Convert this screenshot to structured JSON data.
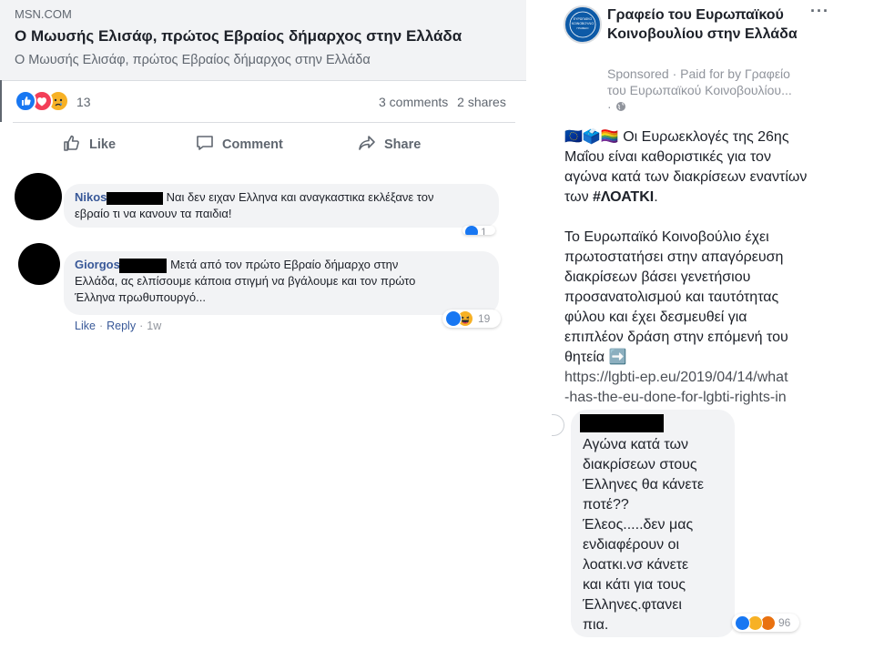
{
  "link_preview": {
    "domain": "MSN.COM",
    "title": "Ο Μωυσής Ελισάφ, πρώτος Εβραίος δήμαρχος στην Ελλάδα",
    "description": "Ο Μωυσής Ελισάφ, πρώτος Εβραίος δήμαρχος στην Ελλάδα"
  },
  "post_stats": {
    "reaction_count": "13",
    "comments": "3 comments",
    "shares": "2 shares",
    "reaction_icons": [
      "like-icon",
      "love-icon",
      "sad-icon"
    ]
  },
  "actions": {
    "like": "Like",
    "comment": "Comment",
    "share": "Share"
  },
  "comments": [
    {
      "author": "Nikos",
      "text_line1": "Ναι δεν ειχαν Ελληνα και αναγκαστικα εκλέξανε τον",
      "text_line2": "εβραίο τι να κανουν τα παιδια!",
      "reaction_count": "1"
    },
    {
      "author": "Giorgos",
      "text_line1": "Μετά από τον πρώτο Εβραίο δήμαρχο στην",
      "text_line2": "Ελλάδα, ας ελπίσουμε κάποια στιγμή να βγάλουμε και τον πρώτο",
      "text_line3": "Έλληνα πρωθυπουργό...",
      "like_label": "Like",
      "reply_label": "Reply",
      "time": "1w",
      "reaction_count": "19",
      "reaction_icons": [
        "like-icon",
        "haha-icon"
      ]
    }
  ],
  "sponsored_post": {
    "page_name": "Γραφείο του Ευρωπαϊκού Κοινοβουλίου στην Ελλάδα",
    "more": "···",
    "sponsored_line1": "Sponsored · Paid for by Γραφείο",
    "sponsored_line2": "του Ευρωπαϊκού Κοινοβουλίου...",
    "emojis": "🇪🇺🗳️🏳️‍🌈",
    "p1_line1": "Οι Ευρωεκλογές της 26ης",
    "p1_line2": "Μαΐου είναι καθοριστικές για τον",
    "p1_line3": "αγώνα κατά των διακρίσεων εναντίων",
    "p1_line4_prefix": "των ",
    "hashtag": "#ΛΟΑΤΚΙ",
    "p1_line4_suffix": ".",
    "p2_line1": "Το Ευρωπαϊκό Κοινοβούλιο έχει",
    "p2_line2": "πρωτοστατήσει στην απαγόρευση",
    "p2_line3": "διακρίσεων βάσει γενετήσιου",
    "p2_line4": "προσανατολισμού και ταυτότητας",
    "p2_line5": "φύλου και έχει δεσμευθεί για",
    "p2_line6": "επιπλέον δράση στην επόμενή του",
    "p2_line7": "θητεία ➡️",
    "link_line1": "https://lgbti-ep.eu/2019/04/14/what",
    "link_line2": "-has-the-eu-done-for-lgbti-rights-in"
  },
  "reply_comment": {
    "lines": [
      "Αγώνα κατά των",
      "διακρίσεων στους",
      "Έλληνες θα κάνετε",
      "ποτέ??",
      "Έλεος.....δεν μας",
      "ενδιαφέρουν οι",
      "λοατκι.νσ κάνετε",
      "και κάτι για τους",
      "Έλληνες.φτανει",
      "πια."
    ],
    "reaction_count": "96",
    "reaction_icons": [
      "like-icon",
      "haha-icon",
      "angry-icon"
    ]
  },
  "colors": {
    "link_blue": "#385898",
    "like_blue": "#1877f2",
    "love_red": "#f33e58",
    "reaction_yellow": "#f7b125",
    "angry_orange": "#e9710f"
  }
}
